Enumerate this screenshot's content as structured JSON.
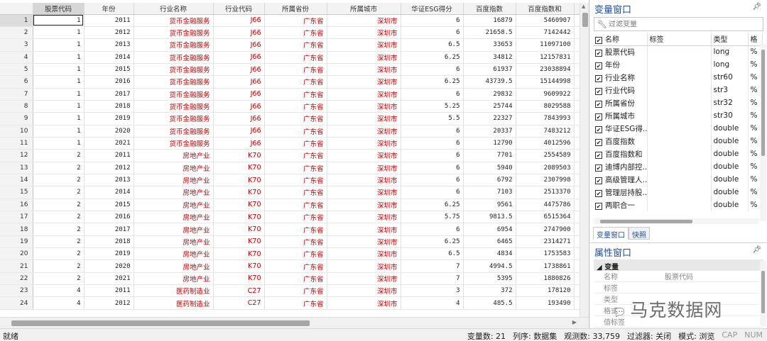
{
  "grid": {
    "columns": [
      "股票代码",
      "年份",
      "行业名称",
      "行业代码",
      "所属省份",
      "所属城市",
      "华证ESG得分",
      "百度指数",
      "百度指数和"
    ],
    "rows": [
      {
        "no": "1",
        "cells": [
          "1",
          "2011",
          "货币金融服务",
          "J66",
          "广东省",
          "深圳市",
          "6",
          "16879",
          "5460907"
        ]
      },
      {
        "no": "2",
        "cells": [
          "1",
          "2012",
          "货币金融服务",
          "J66",
          "广东省",
          "深圳市",
          "6",
          "21658.5",
          "7142442"
        ]
      },
      {
        "no": "3",
        "cells": [
          "1",
          "2013",
          "货币金融服务",
          "J66",
          "广东省",
          "深圳市",
          "6.5",
          "33653",
          "11097100"
        ]
      },
      {
        "no": "4",
        "cells": [
          "1",
          "2014",
          "货币金融服务",
          "J66",
          "广东省",
          "深圳市",
          "6.25",
          "34812",
          "12157831"
        ]
      },
      {
        "no": "5",
        "cells": [
          "1",
          "2015",
          "货币金融服务",
          "J66",
          "广东省",
          "深圳市",
          "6",
          "61937",
          "23038894"
        ]
      },
      {
        "no": "6",
        "cells": [
          "1",
          "2016",
          "货币金融服务",
          "J66",
          "广东省",
          "深圳市",
          "6.25",
          "43739.5",
          "15144998"
        ]
      },
      {
        "no": "7",
        "cells": [
          "1",
          "2017",
          "货币金融服务",
          "J66",
          "广东省",
          "深圳市",
          "6",
          "29832",
          "9609922"
        ]
      },
      {
        "no": "8",
        "cells": [
          "1",
          "2018",
          "货币金融服务",
          "J66",
          "广东省",
          "深圳市",
          "5.25",
          "25744",
          "8029588"
        ]
      },
      {
        "no": "9",
        "cells": [
          "1",
          "2019",
          "货币金融服务",
          "J66",
          "广东省",
          "深圳市",
          "5.5",
          "22327",
          "7843993"
        ]
      },
      {
        "no": "10",
        "cells": [
          "1",
          "2020",
          "货币金融服务",
          "J66",
          "广东省",
          "深圳市",
          "6",
          "20337",
          "7483212"
        ]
      },
      {
        "no": "11",
        "cells": [
          "1",
          "2021",
          "货币金融服务",
          "J66",
          "广东省",
          "深圳市",
          "6",
          "12790",
          "4012596"
        ]
      },
      {
        "no": "12",
        "cells": [
          "2",
          "2011",
          "房地产业",
          "K70",
          "广东省",
          "深圳市",
          "6",
          "7701",
          "2554589"
        ]
      },
      {
        "no": "13",
        "cells": [
          "2",
          "2012",
          "房地产业",
          "K70",
          "广东省",
          "深圳市",
          "6",
          "5940",
          "2089503"
        ]
      },
      {
        "no": "14",
        "cells": [
          "2",
          "2013",
          "房地产业",
          "K70",
          "广东省",
          "深圳市",
          "6",
          "6792",
          "2307998"
        ]
      },
      {
        "no": "15",
        "cells": [
          "2",
          "2014",
          "房地产业",
          "K70",
          "广东省",
          "深圳市",
          "6",
          "7103",
          "2513370"
        ]
      },
      {
        "no": "16",
        "cells": [
          "2",
          "2015",
          "房地产业",
          "K70",
          "广东省",
          "深圳市",
          "6.25",
          "9561",
          "4475786"
        ]
      },
      {
        "no": "17",
        "cells": [
          "2",
          "2016",
          "房地产业",
          "K70",
          "广东省",
          "深圳市",
          "5.75",
          "9813.5",
          "6515364"
        ]
      },
      {
        "no": "18",
        "cells": [
          "2",
          "2017",
          "房地产业",
          "K70",
          "广东省",
          "深圳市",
          "6",
          "6954",
          "2747900"
        ]
      },
      {
        "no": "19",
        "cells": [
          "2",
          "2018",
          "房地产业",
          "K70",
          "广东省",
          "深圳市",
          "6.25",
          "6465",
          "2314271"
        ]
      },
      {
        "no": "20",
        "cells": [
          "2",
          "2019",
          "房地产业",
          "K70",
          "广东省",
          "深圳市",
          "6.5",
          "4834",
          "1753583"
        ]
      },
      {
        "no": "21",
        "cells": [
          "2",
          "2020",
          "房地产业",
          "K70",
          "广东省",
          "深圳市",
          "7",
          "4994.5",
          "1738861"
        ]
      },
      {
        "no": "22",
        "cells": [
          "2",
          "2021",
          "房地产业",
          "K70",
          "广东省",
          "深圳市",
          "7",
          "5395",
          "1880826"
        ]
      },
      {
        "no": "23",
        "cells": [
          "4",
          "2011",
          "医药制造业",
          "C27",
          "广东省",
          "深圳市",
          "3",
          "372",
          "178120"
        ]
      },
      {
        "no": "24",
        "cells": [
          "4",
          "2012",
          "医药制造业",
          "C27",
          "广东省",
          "深圳市",
          "4",
          "485.5",
          "193490"
        ]
      }
    ]
  },
  "variables_window": {
    "title": "变量窗口",
    "filter_placeholder": "过滤变量",
    "headers": {
      "name": "名称",
      "label": "标签",
      "type": "类型",
      "format": "格"
    },
    "items": [
      {
        "name": "股票代码",
        "type": "long",
        "format": "%"
      },
      {
        "name": "年份",
        "type": "long",
        "format": "%"
      },
      {
        "name": "行业名称",
        "type": "str60",
        "format": "%"
      },
      {
        "name": "行业代码",
        "type": "str3",
        "format": "%"
      },
      {
        "name": "所属省份",
        "type": "str32",
        "format": "%"
      },
      {
        "name": "所属城市",
        "type": "str30",
        "format": "%"
      },
      {
        "name": "华证ESG得...",
        "type": "double",
        "format": "%"
      },
      {
        "name": "百度指数",
        "type": "double",
        "format": "%"
      },
      {
        "name": "百度指数和",
        "type": "double",
        "format": "%"
      },
      {
        "name": "迪博内部控...",
        "type": "double",
        "format": "%"
      },
      {
        "name": "高级管理人...",
        "type": "double",
        "format": "%"
      },
      {
        "name": "管理层持股...",
        "type": "double",
        "format": "%"
      },
      {
        "name": "两职合一",
        "type": "double",
        "format": "%"
      }
    ],
    "tabs": [
      "变量窗口",
      "快照"
    ]
  },
  "properties_window": {
    "title": "属性窗口",
    "group": "变量",
    "rows": [
      {
        "key": "名称",
        "value": "股票代码"
      },
      {
        "key": "标签",
        "value": ""
      },
      {
        "key": "类型",
        "value": ""
      },
      {
        "key": "格式",
        "value": ""
      },
      {
        "key": "值标签",
        "value": ""
      }
    ]
  },
  "watermark": "马克数据网",
  "status_bar": {
    "ready": "就绪",
    "var_count": "变量数: 21",
    "order": "列序: 数据集",
    "obs": "观测数: 33,759",
    "filter": "过滤器: 关闭",
    "mode": "模式: 浏览",
    "cap": "CAP",
    "num": "NUM"
  },
  "colors": {
    "string_value": "#c00000",
    "panel_title": "#1f4e9c"
  },
  "icons": [
    "pin-icon",
    "wrench-icon",
    "checkbox-icon",
    "scroll-arrow-icon",
    "wechat-icon"
  ]
}
